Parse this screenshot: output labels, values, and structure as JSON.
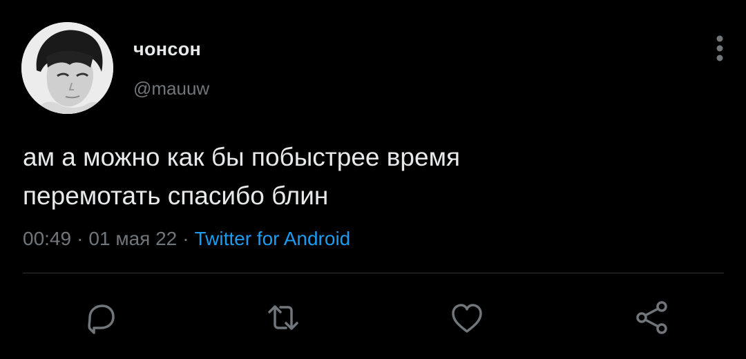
{
  "tweet": {
    "author": {
      "display_name": "чонсон",
      "handle": "@mauuw"
    },
    "text": "ам а можно как бы побыстрее время\nперемотать спасибо блин",
    "time": "00:49",
    "date": "01 мая 22",
    "separator": "·",
    "source": "Twitter for Android"
  },
  "actions": {
    "reply_icon": "reply-bubble-icon",
    "retweet_icon": "retweet-arrows-icon",
    "like_icon": "heart-icon",
    "share_icon": "share-nodes-icon",
    "more_icon": "vertical-ellipsis-icon"
  },
  "colors": {
    "background": "#000000",
    "text_primary": "#e7e9ea",
    "text_secondary": "#71767b",
    "accent": "#1d9bf0",
    "divider": "#2f3336"
  }
}
